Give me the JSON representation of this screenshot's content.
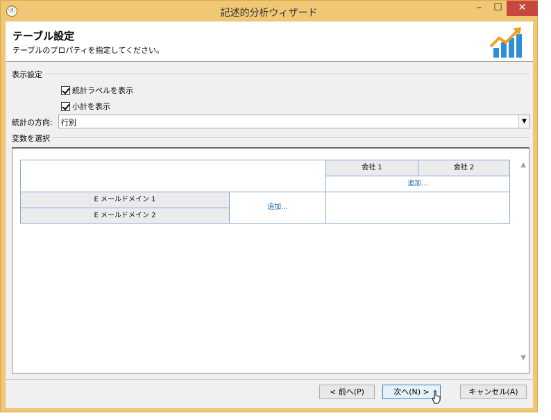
{
  "window": {
    "title": "記述的分析ウィザード",
    "app_icon_glyph": "ⓓ",
    "minimize_glyph": "–",
    "maximize_glyph": "☐",
    "close_glyph": "✕"
  },
  "header": {
    "title": "テーブル設定",
    "subtitle": "テーブルのプロパティを指定してください。",
    "logo_icon": "bar-chart-growth-icon",
    "colors": {
      "bars": "#2e8fd6",
      "arrow": "#f0a020"
    }
  },
  "display_settings": {
    "group_label": "表示設定",
    "show_stat_labels": {
      "label": "統計ラベルを表示",
      "checked": true
    },
    "show_subtotals": {
      "label": "小計を表示",
      "checked": true
    }
  },
  "stat_direction": {
    "label": "統計の方向:",
    "value": "行別"
  },
  "variables": {
    "group_label": "変数を選択",
    "column_headers": [
      "会社 1",
      "会社 2"
    ],
    "column_add": "追加...",
    "row_headers": [
      "E メールドメイン 1",
      "E メールドメイン 2"
    ],
    "row_add": "追加..."
  },
  "footer": {
    "prev_label": "< 前へ(P)",
    "next_label": "次へ(N) >",
    "cancel_label": "キャンセル(A)"
  }
}
